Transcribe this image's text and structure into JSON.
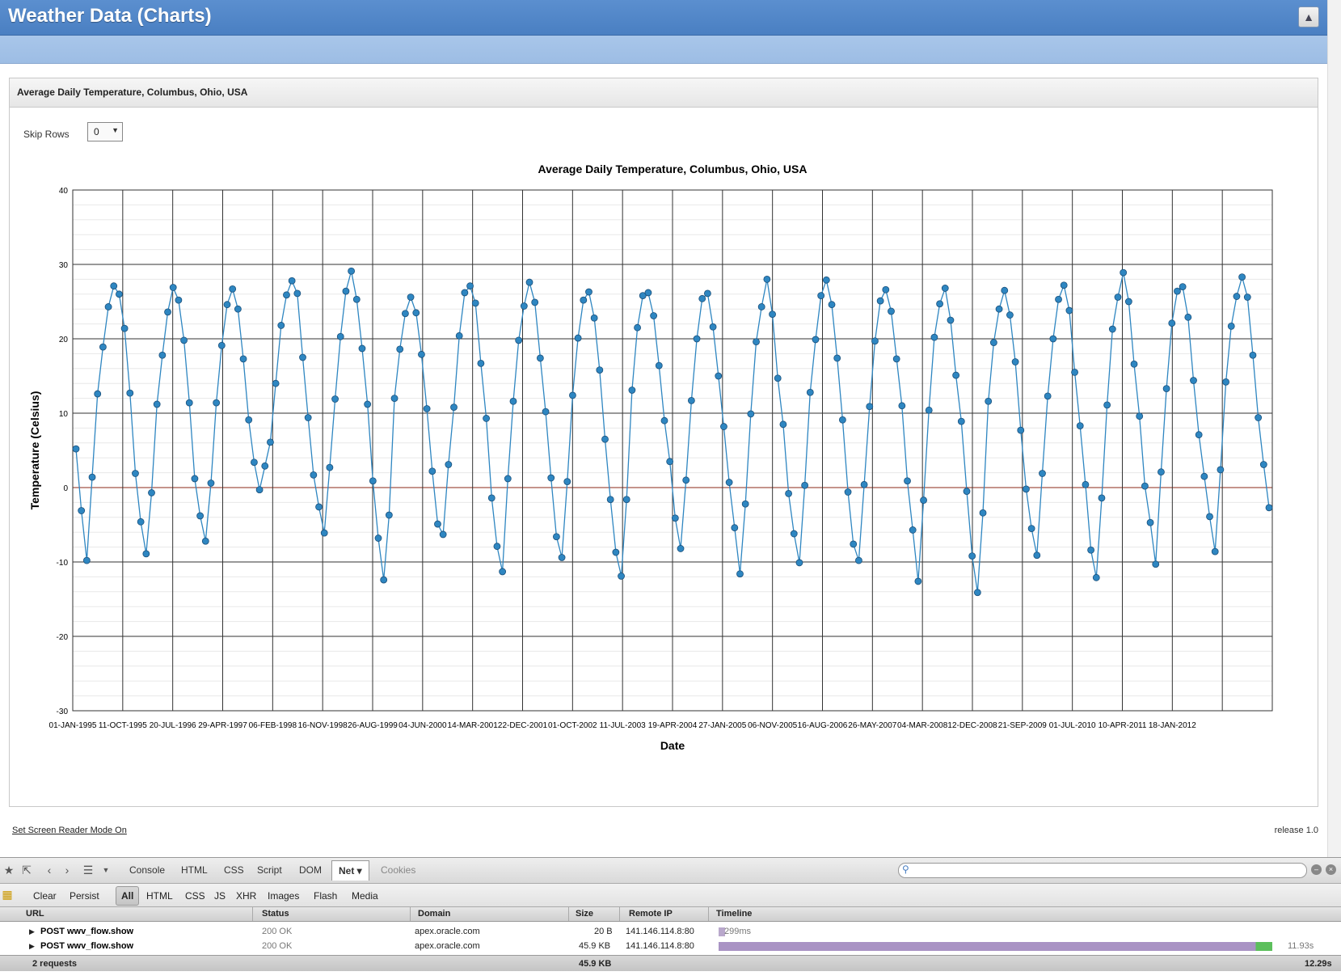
{
  "app": {
    "title": "Weather Data (Charts)",
    "user_icon": "user-icon"
  },
  "region": {
    "title": "Average Daily Temperature, Columbus, Ohio, USA"
  },
  "skip_rows": {
    "label": "Skip Rows",
    "value": "0"
  },
  "chart_data": {
    "type": "line",
    "title": "Average Daily Temperature, Columbus, Ohio, USA",
    "xlabel": "Date",
    "ylabel": "Temperature (Celsius)",
    "ylim": [
      -30,
      40
    ],
    "yticks": [
      40,
      30,
      20,
      10,
      0,
      -10,
      -20,
      -30
    ],
    "xticks": [
      "01-JAN-1995",
      "11-OCT-1995",
      "20-JUL-1996",
      "29-APR-1997",
      "06-FEB-1998",
      "16-NOV-1998",
      "26-AUG-1999",
      "04-JUN-2000",
      "14-MAR-2001",
      "22-DEC-2001",
      "01-OCT-2002",
      "11-JUL-2003",
      "19-APR-2004",
      "27-JAN-2005",
      "06-NOV-2005",
      "16-AUG-2006",
      "26-MAY-2007",
      "04-MAR-2008",
      "12-DEC-2008",
      "21-SEP-2009",
      "01-JUL-2010",
      "10-APR-2011",
      "18-JAN-2012"
    ],
    "grid": true,
    "series_color": "#2e86c1",
    "series": [
      {
        "values": [
          5.2,
          -3.1,
          -9.8,
          1.4,
          12.6,
          18.9,
          24.3,
          27.1,
          26.0,
          21.4,
          12.7,
          1.9,
          -4.6,
          -8.9,
          -0.7,
          11.2,
          17.8,
          23.6,
          26.9,
          25.2,
          19.8,
          11.4,
          1.2,
          -3.8,
          -7.2,
          0.6,
          11.4,
          19.1,
          24.6,
          26.7,
          24.0,
          17.3,
          9.1,
          3.4,
          -0.3,
          2.9,
          6.1,
          14.0,
          21.8,
          25.9,
          27.8,
          26.1,
          17.5,
          9.4,
          1.7,
          -2.6,
          -6.1,
          2.7,
          11.9,
          20.3,
          26.4,
          29.1,
          25.3,
          18.7,
          11.2,
          0.9,
          -6.8,
          -12.4,
          -3.7,
          12.0,
          18.6,
          23.4,
          25.6,
          23.5,
          17.9,
          10.6,
          2.2,
          -4.9,
          -6.3,
          3.1,
          10.8,
          20.4,
          26.2,
          27.1,
          24.8,
          16.7,
          9.3,
          -1.4,
          -7.9,
          -11.3,
          1.2,
          11.6,
          19.8,
          24.4,
          27.6,
          24.9,
          17.4,
          10.2,
          1.3,
          -6.6,
          -9.4,
          0.8,
          12.4,
          20.1,
          25.2,
          26.3,
          22.8,
          15.8,
          6.5,
          -1.6,
          -8.7,
          -11.9,
          -1.6,
          13.1,
          21.5,
          25.8,
          26.2,
          23.1,
          16.4,
          9.0,
          3.5,
          -4.1,
          -8.2,
          1.0,
          11.7,
          20.0,
          25.4,
          26.1,
          21.6,
          15.0,
          8.2,
          0.7,
          -5.4,
          -11.6,
          -2.2,
          9.9,
          19.6,
          24.3,
          28.0,
          23.3,
          14.7,
          8.5,
          -0.8,
          -6.2,
          -10.1,
          0.3,
          12.8,
          19.9,
          25.8,
          27.9,
          24.6,
          17.4,
          9.1,
          -0.6,
          -7.6,
          -9.8,
          0.4,
          10.9,
          19.7,
          25.1,
          26.6,
          23.7,
          17.3,
          11.0,
          0.9,
          -5.7,
          -12.6,
          -1.7,
          10.4,
          20.2,
          24.7,
          26.8,
          22.5,
          15.1,
          8.9,
          -0.5,
          -9.2,
          -14.1,
          -3.4,
          11.6,
          19.5,
          24.0,
          26.5,
          23.2,
          16.9,
          7.7,
          -0.2,
          -5.5,
          -9.1,
          1.9,
          12.3,
          20.0,
          25.3,
          27.2,
          23.8,
          15.5,
          8.3,
          0.4,
          -8.4,
          -12.1,
          -1.4,
          11.1,
          21.3,
          25.6,
          28.9,
          25.0,
          16.6,
          9.6,
          0.2,
          -4.7,
          -10.3,
          2.1,
          13.3,
          22.1,
          26.4,
          27.0,
          22.9,
          14.4,
          7.1,
          1.5,
          -3.9,
          -8.6,
          2.4,
          14.2,
          21.7,
          25.7,
          28.3,
          25.6,
          17.8,
          9.4,
          3.1,
          -2.7
        ]
      }
    ]
  },
  "footer": {
    "screen_reader": "Set Screen Reader Mode On",
    "release": "release 1.0"
  },
  "firebug": {
    "tabs": [
      "Console",
      "HTML",
      "CSS",
      "Script",
      "DOM",
      "Net",
      "Cookies"
    ],
    "active_tab": "Net ▾",
    "filters": [
      "Clear",
      "Persist",
      "All",
      "HTML",
      "CSS",
      "JS",
      "XHR",
      "Images",
      "Flash",
      "Media"
    ],
    "columns": [
      "URL",
      "Status",
      "Domain",
      "Size",
      "Remote IP",
      "Timeline"
    ],
    "rows": [
      {
        "url": "POST wwv_flow.show",
        "status": "200 OK",
        "domain": "apex.oracle.com",
        "size": "20 B",
        "ip": "141.146.114.8:80",
        "time": "299ms",
        "fraction": 0.012
      },
      {
        "url": "POST wwv_flow.show",
        "status": "200 OK",
        "domain": "apex.oracle.com",
        "size": "45.9 KB",
        "ip": "141.146.114.8:80",
        "time": "11.93s",
        "fraction": 0.976
      }
    ],
    "total": {
      "requests": "2 requests",
      "size": "45.9 KB",
      "time": "12.29s"
    }
  }
}
